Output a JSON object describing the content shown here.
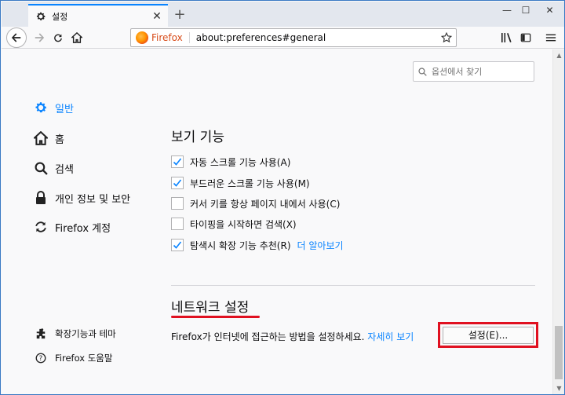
{
  "browser": {
    "tab": {
      "title": "설정",
      "icon": "gear-icon"
    },
    "new_tab": "+",
    "window_controls": {
      "minimize": "—",
      "maximize": "☐",
      "close": "✕"
    },
    "url": {
      "brand": "Firefox",
      "address": "about:preferences#general"
    },
    "nav_icons": [
      "back-icon",
      "forward-icon",
      "reload-icon",
      "home-icon",
      "bookmark-star-icon",
      "library-icon",
      "sidebar-icon",
      "menu-icon"
    ]
  },
  "search": {
    "placeholder": "옵션에서 찾기"
  },
  "sidebar": {
    "items": [
      {
        "label": "일반",
        "icon": "gear-icon",
        "active": true
      },
      {
        "label": "홈",
        "icon": "home-icon"
      },
      {
        "label": "검색",
        "icon": "search-icon"
      },
      {
        "label": "개인 정보 및 보안",
        "icon": "lock-icon"
      },
      {
        "label": "Firefox 계정",
        "icon": "sync-icon"
      }
    ],
    "footer": [
      {
        "label": "확장기능과 테마",
        "icon": "puzzle-icon"
      },
      {
        "label": "Firefox 도움말",
        "icon": "help-icon"
      }
    ]
  },
  "browsing": {
    "title": "보기 기능",
    "options": [
      {
        "label": "자동 스크롤 기능 사용(A)",
        "checked": true
      },
      {
        "label": "부드러운 스크롤 기능 사용(M)",
        "checked": true
      },
      {
        "label": "커서 키를 항상 페이지 내에서 사용(C)",
        "checked": false
      },
      {
        "label": "타이핑을 시작하면 검색(X)",
        "checked": false
      },
      {
        "label": "탐색시 확장 기능 추천(R)",
        "checked": true,
        "link": "더 알아보기"
      }
    ]
  },
  "network": {
    "title": "네트워크 설정",
    "description": "Firefox가 인터넷에 접근하는 방법을 설정하세요.",
    "link": "자세히 보기",
    "button": "설정(E)..."
  },
  "colors": {
    "accent": "#0a84ff",
    "highlight": "#e01020"
  }
}
